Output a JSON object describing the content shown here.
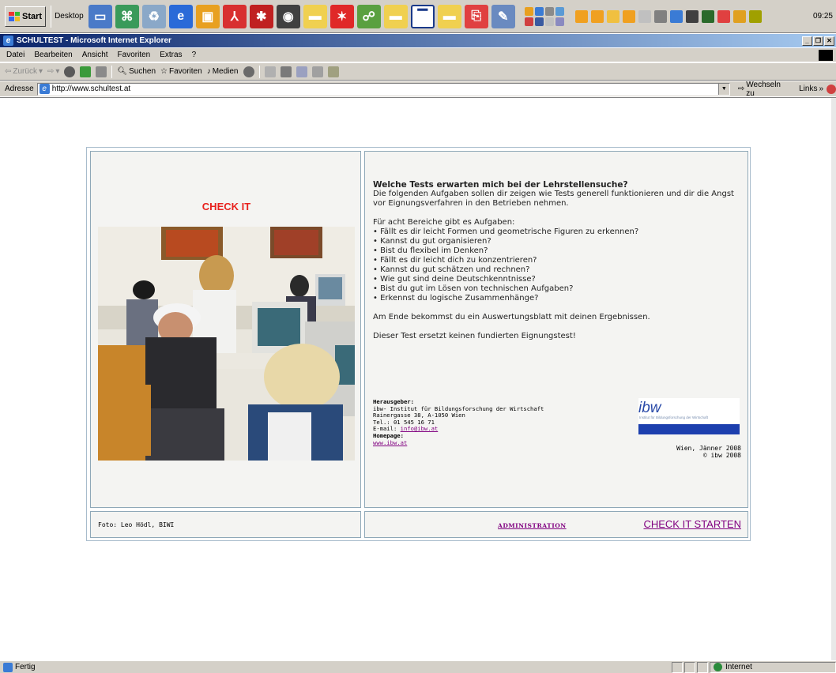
{
  "taskbar": {
    "start_label": "Start",
    "desktop_label": "Desktop",
    "clock": "09:25",
    "quicklaunch_icons": [
      "computer-icon",
      "network-icon",
      "recycle-icon",
      "ie-icon",
      "photo-icon",
      "pdf-icon",
      "gear-icon",
      "panda-icon",
      "folder-icon",
      "star-icon",
      "network-places-icon",
      "folder-icon",
      "window-icon",
      "folder-icon",
      "pdf-icon",
      "scanner-icon"
    ]
  },
  "window": {
    "title": "SCHULTEST - Microsoft Internet Explorer"
  },
  "menu": {
    "items": [
      "Datei",
      "Bearbeiten",
      "Ansicht",
      "Favoriten",
      "Extras",
      "?"
    ]
  },
  "toolbar": {
    "back": "Zurück",
    "search": "Suchen",
    "favorites": "Favoriten",
    "media": "Medien"
  },
  "address": {
    "label": "Adresse",
    "url": "http://www.schultest.at",
    "go": "Wechseln zu",
    "links": "Links"
  },
  "page": {
    "check_it": "CHECK IT",
    "heading": "Welche Tests erwarten mich bei der Lehrstellensuche?",
    "intro": "Die folgenden Aufgaben sollen dir zeigen wie Tests generell funktionieren und dir die Angst vor Eignungsverfahren in den Betrieben nehmen.",
    "areas_intro": "Für acht Bereiche gibt es Aufgaben:",
    "areas": [
      "Fällt es dir leicht Formen und geometrische Figuren zu erkennen?",
      "Kannst du gut organisieren?",
      "Bist du flexibel im Denken?",
      "Fällt es dir leicht dich zu konzentrieren?",
      "Kannst du gut schätzen und rechnen?",
      "Wie gut sind deine Deutschkenntnisse?",
      "Bist du gut im Lösen von technischen Aufgaben?",
      "Erkennst du logische Zusammenhänge?"
    ],
    "result_note": "Am Ende bekommst du ein Auswertungsblatt mit deinen Ergebnissen.",
    "disclaimer": "Dieser Test ersetzt keinen fundierten Eignungstest!",
    "publisher": {
      "label": "Herausgeber:",
      "name": "ibw- Institut für Bildungsforschung der Wirtschaft",
      "address": "Rainergasse 38, A-1050 Wien",
      "tel": "Tel.: 01 545 16 71",
      "email_label": "E-mail:",
      "email": "info@ibw.at",
      "homepage_label": "Homepage:",
      "homepage": "www.ibw.at"
    },
    "logo_text": "ibw",
    "logo_subtitle": "Institut für Bildungsforschung der Wirtschaft",
    "date": "Wien, Jänner 2008",
    "copyright": "© ibw 2008",
    "photo_credit": "Foto: Leo Hödl, BIWI",
    "admin_link": "ADMINISTRATION",
    "start_link": "CHECK IT STARTEN"
  },
  "status": {
    "text": "Fertig",
    "zone": "Internet"
  }
}
